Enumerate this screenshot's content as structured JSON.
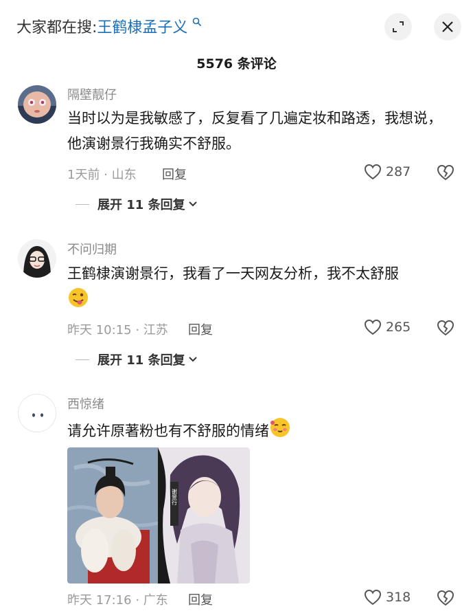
{
  "header": {
    "search_prefix": "大家都在搜:",
    "search_keyword": "王鹤棣孟子义",
    "search_icon": "search-icon",
    "shrink_icon": "shrink-icon",
    "close_icon": "close-icon"
  },
  "comment_count_label": "5576 条评论",
  "comments": [
    {
      "username": "隔壁靓仔",
      "text": "当时以为是我敏感了，反复看了几遍定妆和路透，我想说，他演谢景行我确实不舒服。",
      "meta": "1天前 · 山东",
      "reply": "回复",
      "likes": "287",
      "expand": "展开 11 条回复"
    },
    {
      "username": "不问归期",
      "text": "王鹤棣演谢景行，我看了一天网友分析，我不太舒服",
      "emoji": "winking-tongue-emoji",
      "meta": "昨天 10:15 · 江苏",
      "reply": "回复",
      "likes": "265",
      "expand": "展开 11 条回复"
    },
    {
      "username": "西惊绪",
      "text": "请允许原著粉也有不舒服的情绪",
      "emoji": "blushing-wink-emoji",
      "photo_caption": "谢景行",
      "meta": "昨天 17:16 · 广东",
      "reply": "回复",
      "likes": "318"
    }
  ],
  "colors": {
    "keyword": "#1b6fb8",
    "muted": "#9a9a9a",
    "text": "#1a1a1a"
  }
}
